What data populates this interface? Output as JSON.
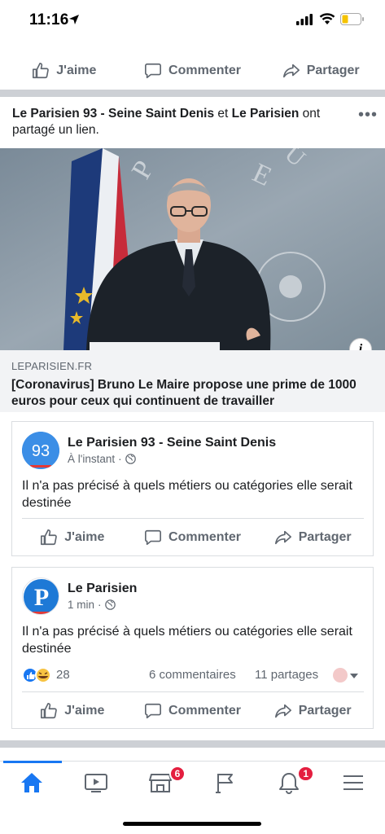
{
  "status_bar": {
    "time": "11:16"
  },
  "top_actions": {
    "like": "J'aime",
    "comment": "Commenter",
    "share": "Partager"
  },
  "post": {
    "page1": "Le Parisien 93 - Seine Saint Denis",
    "connector": " et ",
    "page2": "Le Parisien",
    "suffix": " ont partagé un lien.",
    "link": {
      "domain": "LEPARISIEN.FR",
      "title": "[Coronavirus] Bruno Le Maire propose une prime de 1000 euros pour ceux qui continuent de travailler"
    }
  },
  "shares": [
    {
      "avatar_text": "93",
      "name": "Le Parisien 93 - Seine Saint Denis",
      "time": "À l'instant",
      "text": "Il n'a pas précisé à quels métiers ou catégories elle serait destinée",
      "actions": {
        "like": "J'aime",
        "comment": "Commenter",
        "share": "Partager"
      }
    },
    {
      "avatar_text": "P",
      "name": "Le Parisien",
      "time": "1 min",
      "text": "Il n'a pas précisé à quels métiers ou catégories elle serait destinée",
      "reactions": "28",
      "comments": "6 commentaires",
      "share_count": "11 partages",
      "actions": {
        "like": "J'aime",
        "comment": "Commenter",
        "share": "Partager"
      }
    }
  ],
  "bottom_nav": {
    "marketplace_badge": "6",
    "notifications_badge": "1"
  },
  "colors": {
    "accent": "#1877f2",
    "badge": "#e41e3f",
    "secondary_text": "#606770"
  }
}
